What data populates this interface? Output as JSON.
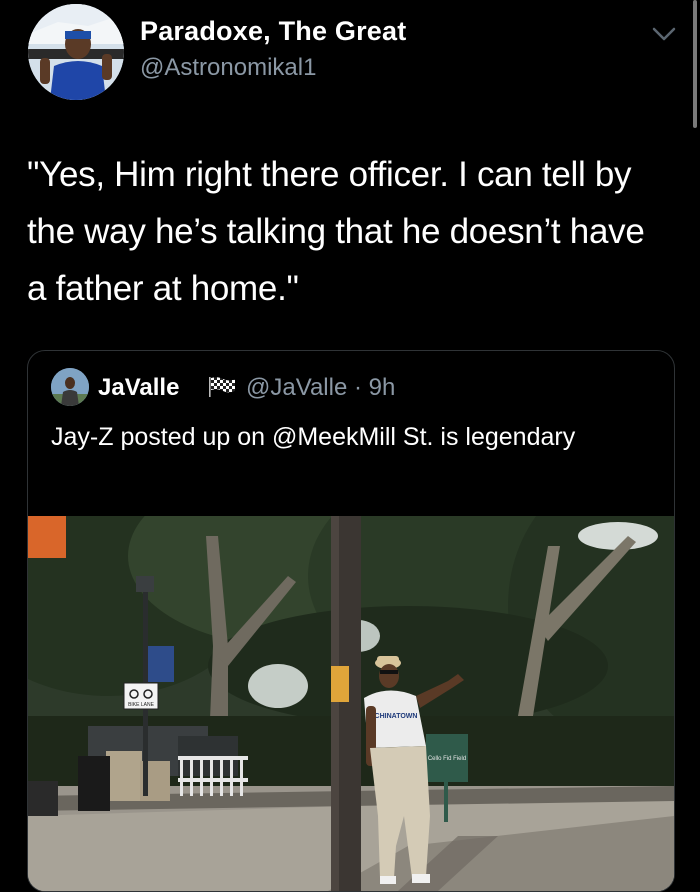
{
  "tweet": {
    "display_name": "Paradoxe, The Great",
    "handle": "@Astronomikal1",
    "text": "\"Yes, Him right there officer. I can tell by the way he’s talking that he doesn’t have a father at home.\""
  },
  "quoted_tweet": {
    "display_name": "JaValle",
    "handle": "@JaValle",
    "separator": " · ",
    "time": "9h",
    "text": "Jay-Z posted up on @MeekMill St. is legendary"
  },
  "photo": {
    "shirt_text": "CHINATOWN",
    "bike_lane_sign": "BIKE LANE",
    "park_sign": "Cello Fid Field"
  },
  "icons": {
    "chevron": "chevron-down-icon",
    "flag": "checkered-flag-icon"
  },
  "colors": {
    "background": "#000000",
    "text_primary": "#ffffff",
    "text_secondary": "#8b98a5",
    "border": "#2f3336"
  }
}
